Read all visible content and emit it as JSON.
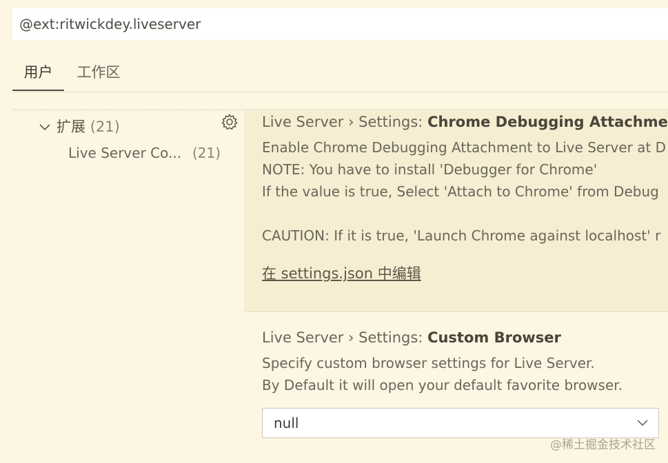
{
  "search": {
    "value": "@ext:ritwickdey.liveserver"
  },
  "tabs": [
    {
      "label": "用户",
      "active": true
    },
    {
      "label": "工作区",
      "active": false
    }
  ],
  "toc": {
    "extensions_label": "扩展",
    "extensions_count": "(21)",
    "sub_label": "Live Server Co...",
    "sub_count": "(21)"
  },
  "settings": [
    {
      "category": "Live Server › Settings: ",
      "name": "Chrome Debugging Attachment",
      "description_lines": [
        "Enable Chrome Debugging Attachment to Live Server at D",
        "NOTE: You have to install 'Debugger for Chrome'",
        "If the value is true, Select 'Attach to Chrome' from Debug",
        "",
        "CAUTION: If it is true, 'Launch Chrome against localhost' r"
      ],
      "edit_link": "在 settings.json 中编辑"
    },
    {
      "category": "Live Server › Settings: ",
      "name": "Custom Browser",
      "description_lines": [
        "Specify custom browser settings for Live Server.",
        "By Default it will open your default favorite browser."
      ],
      "selected_value": "null"
    }
  ],
  "watermark": "@稀土掘金技术社区",
  "icons": {
    "gear": "gear-icon",
    "chevron_down": "chevron-down-icon"
  }
}
